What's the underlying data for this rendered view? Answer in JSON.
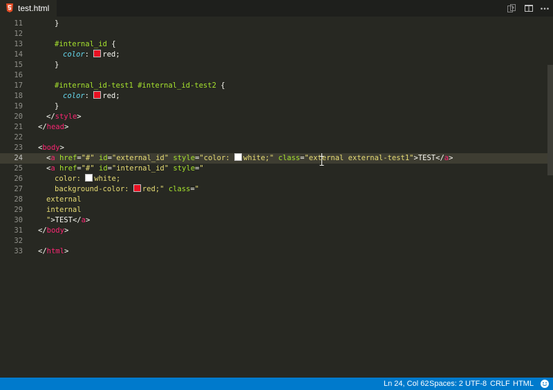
{
  "tab": {
    "filename": "test.html",
    "icon": "html5-icon"
  },
  "titlebar_icons": [
    "open-changes-icon",
    "split-editor-icon",
    "more-actions-icon"
  ],
  "editor": {
    "line_numbers": [
      "11",
      "12",
      "13",
      "14",
      "15",
      "16",
      "17",
      "18",
      "19",
      "20",
      "21",
      "22",
      "23",
      "24",
      "25",
      "26",
      "27",
      "28",
      "29",
      "30",
      "31",
      "32",
      "33"
    ],
    "active_line_number": "24",
    "colors": {
      "red_swatch": "#e81123",
      "white_swatch": "#ffffff"
    },
    "lines": {
      "l11": {
        "brace": "}"
      },
      "l13": {
        "selector": "#internal_id",
        "brace": "{"
      },
      "l14": {
        "prop": "color",
        "colon": ":",
        "value": "red",
        "semi": ";"
      },
      "l15": {
        "brace": "}"
      },
      "l17": {
        "selector": "#internal_id-test1 #internal_id-test2",
        "brace": "{"
      },
      "l18": {
        "prop": "color",
        "colon": ":",
        "value": "red",
        "semi": ";"
      },
      "l19": {
        "brace": "}"
      },
      "l20": {
        "open": "</",
        "tag": "style",
        "close": ">"
      },
      "l21": {
        "open": "</",
        "tag": "head",
        "close": ">"
      },
      "l23": {
        "open": "<",
        "tag": "body",
        "close": ">"
      },
      "l24": {
        "lt": "<",
        "tag": "a",
        "a1": "href",
        "eq": "=",
        "v1": "\"#\"",
        "a2": "id",
        "v2": "\"external_id\"",
        "a3": "style",
        "v3a": "\"color: ",
        "v3b": "white;\"",
        "a4": "class",
        "v4a": "\"ext",
        "v4b": "ernal external-test1\"",
        "gt": ">",
        "text": "TEST",
        "close_lt": "</",
        "close_tag": "a",
        "close_gt": ">"
      },
      "l25": {
        "lt": "<",
        "tag": "a",
        "a1": "href",
        "eq": "=",
        "v1": "\"#\"",
        "a2": "id",
        "v2": "\"internal_id\"",
        "a3": "style",
        "v3": "\""
      },
      "l26": {
        "a": "color: ",
        "b": "white;"
      },
      "l27": {
        "a": "background-color: ",
        "b": "red;\"",
        "attr": "class",
        "eq": "=",
        "val": "\""
      },
      "l28": {
        "text": "external"
      },
      "l29": {
        "text": "internal"
      },
      "l30": {
        "q": "\"",
        "gt": ">",
        "text": "TEST",
        "close_lt": "</",
        "close_tag": "a",
        "close_gt": ">"
      },
      "l31": {
        "open": "</",
        "tag": "body",
        "close": ">"
      },
      "l33": {
        "open": "</",
        "tag": "html",
        "close": ">"
      }
    }
  },
  "statusbar": {
    "position": "Ln 24, Col 62",
    "indent": "Spaces: 2",
    "encoding": "UTF-8",
    "eol": "CRLF",
    "language": "HTML",
    "feedback_icon": "smiley-icon"
  }
}
